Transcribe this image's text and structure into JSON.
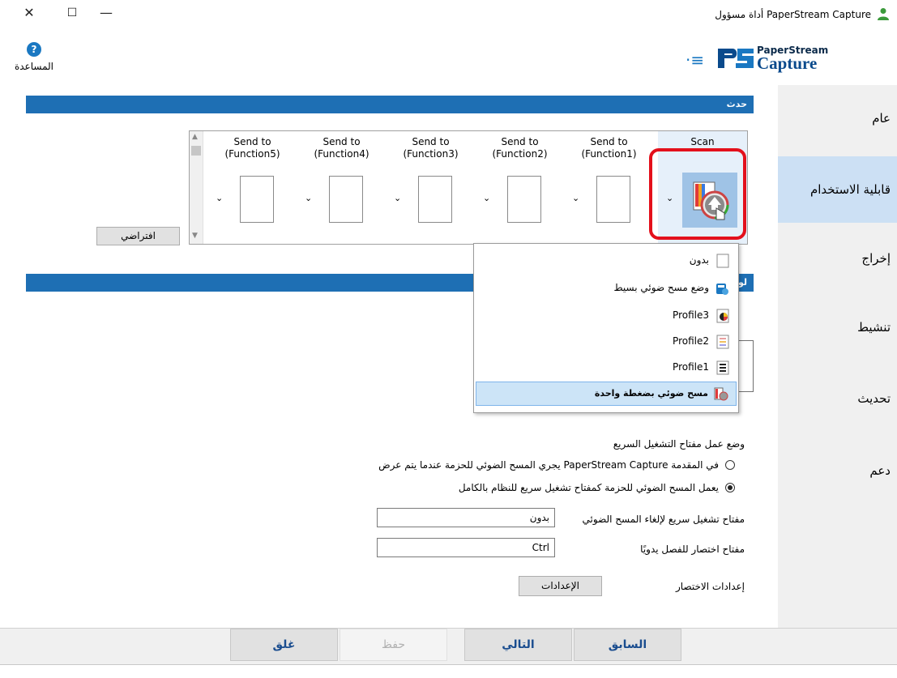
{
  "window": {
    "title": "أداة مسؤول PaperStream Capture",
    "close_glyph": "✕",
    "maximize_glyph": "☐",
    "minimize_glyph": "—"
  },
  "help": {
    "label": "المساعدة",
    "glyph": "?"
  },
  "brand": {
    "menu_glyph": "·≡",
    "top": "PaperStream",
    "bottom": "Capture"
  },
  "nav": {
    "items": [
      {
        "label": "عام",
        "selected": false
      },
      {
        "label": "قابلية الاستخدام",
        "selected": true
      },
      {
        "label": "إخراج",
        "selected": false
      },
      {
        "label": "تنشيط",
        "selected": false
      },
      {
        "label": "تحديث",
        "selected": false
      },
      {
        "label": "دعم",
        "selected": false
      }
    ]
  },
  "event_section": {
    "title": "حدث",
    "default_button": "افتراضي",
    "tiles": [
      {
        "label": "Send to (Function5)",
        "line1": "Send to",
        "line2": "(Function5)"
      },
      {
        "label": "Send to (Function4)",
        "line1": "Send to",
        "line2": "(Function4)"
      },
      {
        "label": "Send to (Function3)",
        "line1": "Send to",
        "line2": "(Function3)"
      },
      {
        "label": "Send to (Function2)",
        "line1": "Send to",
        "line2": "(Function2)"
      },
      {
        "label": "Send to (Function1)",
        "line1": "Send to",
        "line2": "(Function1)"
      },
      {
        "label": "Scan",
        "line1": "Scan",
        "line2": ""
      }
    ],
    "dropdown_glyph": "⌄"
  },
  "second_section": {
    "title_visible": "لوح"
  },
  "dropdown_menu": {
    "items": [
      {
        "label": "بدون",
        "icon": "blank-page-icon",
        "selected": false
      },
      {
        "label": "وضع مسح ضوئي بسيط",
        "icon": "simple-scan-icon",
        "selected": false
      },
      {
        "label": "Profile3",
        "icon": "color-profile-icon",
        "selected": false
      },
      {
        "label": "Profile2",
        "icon": "gray-profile-icon",
        "selected": false
      },
      {
        "label": "Profile1",
        "icon": "bw-profile-icon",
        "selected": false
      },
      {
        "label": "مسح ضوئي بضغطة واحدة",
        "icon": "one-touch-scan-icon",
        "selected": true
      }
    ]
  },
  "hotkey": {
    "heading": "وضع عمل مفتاح التشغيل السريع",
    "option1": "يجري المسح الضوئي للحزمة عندما يتم عرض PaperStream Capture في المقدمة",
    "option2": "يعمل المسح الضوئي للحزمة كمفتاح تشغيل سريع للنظام بالكامل",
    "cancel_label": "مفتاح تشغيل سريع لإلغاء المسح الضوئي",
    "cancel_value": "بدون",
    "separate_label": "مفتاح اختصار للفصل يدويًا",
    "separate_value": "Ctrl",
    "shortcut_label": "إعدادات الاختصار",
    "settings_button": "الإعدادات"
  },
  "footer": {
    "close": "غلق",
    "save": "حفظ",
    "next": "التالي",
    "back": "السابق"
  },
  "colors": {
    "accent": "#1e6fb4",
    "highlight_ring": "#e3101c",
    "selected_nav": "#cce0f4"
  }
}
